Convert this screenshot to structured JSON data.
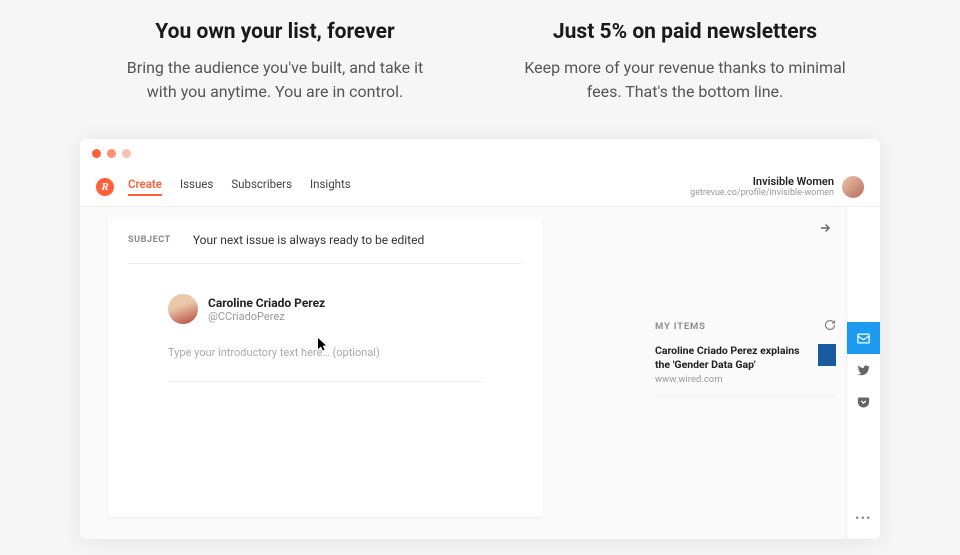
{
  "hero": {
    "left": {
      "title": "You own your list, forever",
      "body": "Bring the audience you've built, and take it with you anytime. You are in control."
    },
    "right": {
      "title": "Just 5% on paid newsletters",
      "body": "Keep more of your revenue thanks to minimal fees. That's the bottom line."
    }
  },
  "app": {
    "logo_letter": "R",
    "nav": {
      "create": "Create",
      "issues": "Issues",
      "subscribers": "Subscribers",
      "insights": "Insights"
    },
    "profile": {
      "name": "Invisible Women",
      "url": "getrevue.co/profile/invisible-women"
    },
    "subject": {
      "label": "SUBJECT",
      "value": "Your next issue is always ready to be edited"
    },
    "author": {
      "name": "Caroline Criado Perez",
      "handle": "@CCriadoPerez"
    },
    "intro_placeholder": "Type your introductory text here… (optional)",
    "my_items": {
      "label": "MY ITEMS",
      "item1": {
        "title": "Caroline Criado Perez explains the 'Gender Data Gap'",
        "source": "www.wired.com"
      }
    },
    "more_dots": "•••"
  }
}
